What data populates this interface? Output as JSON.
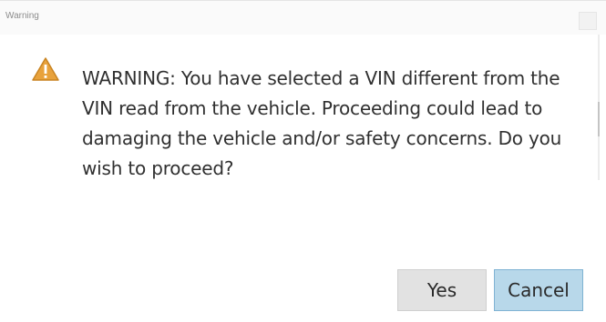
{
  "window": {
    "title": "Warning",
    "icon": "warning-triangle-icon"
  },
  "message": "WARNING:  You have selected a VIN different from the VIN read from the vehicle.  Proceeding could lead to damaging the vehicle and/or safety concerns.  Do you wish to proceed?",
  "buttons": {
    "yes": "Yes",
    "cancel": "Cancel"
  },
  "colors": {
    "warning_icon": "#e8a23c",
    "cancel_button": "#b8d8ea",
    "yes_button": "#e2e2e2"
  }
}
